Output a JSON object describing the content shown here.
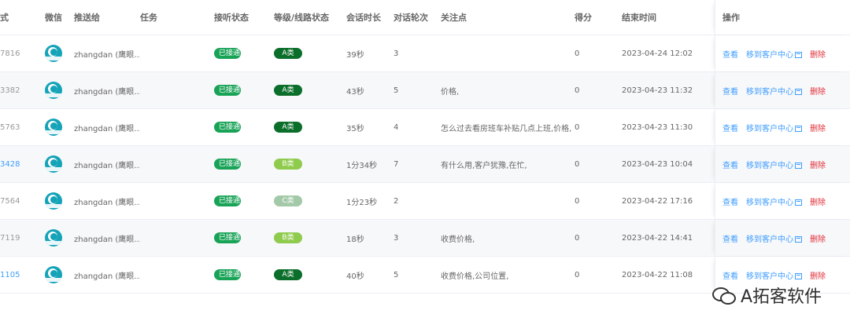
{
  "header": {
    "id": "式",
    "wechat": "微信",
    "push_to": "推送给",
    "task": "任务",
    "listen_status": "接听状态",
    "level": "等级/线路状态",
    "duration": "会话时长",
    "rounds": "对话轮次",
    "focus": "关注点",
    "score": "得分",
    "end_time": "结束时间",
    "ops": "操作"
  },
  "ops": {
    "view": "查看",
    "move": "移到客户中心",
    "delete": "删除"
  },
  "rows": [
    {
      "id": "7816",
      "id_link": false,
      "push_to": "zhangdan (鹰眼...",
      "listen": "已接通",
      "level": "A类",
      "level_class": "A",
      "duration": "39秒",
      "rounds": "3",
      "focus": "",
      "score": "0",
      "end_time": "2023-04-24 12:02"
    },
    {
      "id": "3382",
      "id_link": false,
      "push_to": "zhangdan (鹰眼...",
      "listen": "已接通",
      "level": "A类",
      "level_class": "A",
      "duration": "43秒",
      "rounds": "5",
      "focus": "价格,",
      "score": "0",
      "end_time": "2023-04-23 11:32"
    },
    {
      "id": "5763",
      "id_link": false,
      "push_to": "zhangdan (鹰眼...",
      "listen": "已接通",
      "level": "A类",
      "level_class": "A",
      "duration": "35秒",
      "rounds": "4",
      "focus": "怎么过去看房班车补贴几点上班,价格,",
      "score": "0",
      "end_time": "2023-04-23 11:30"
    },
    {
      "id": "3428",
      "id_link": true,
      "push_to": "zhangdan (鹰眼...",
      "listen": "已接通",
      "level": "B类",
      "level_class": "B",
      "duration": "1分34秒",
      "rounds": "7",
      "focus": "有什么用,客户犹豫,在忙,",
      "score": "0",
      "end_time": "2023-04-23 10:04"
    },
    {
      "id": "7564",
      "id_link": false,
      "push_to": "zhangdan (鹰眼...",
      "listen": "已接通",
      "level": "C类",
      "level_class": "C",
      "duration": "1分23秒",
      "rounds": "2",
      "focus": "",
      "score": "0",
      "end_time": "2023-04-22 17:16"
    },
    {
      "id": "7119",
      "id_link": false,
      "push_to": "zhangdan (鹰眼...",
      "listen": "已接通",
      "level": "B类",
      "level_class": "B",
      "duration": "18秒",
      "rounds": "3",
      "focus": "收费价格,",
      "score": "0",
      "end_time": "2023-04-22 14:41"
    },
    {
      "id": "1105",
      "id_link": true,
      "push_to": "zhangdan (鹰眼...",
      "listen": "已接通",
      "level": "A类",
      "level_class": "A",
      "duration": "40秒",
      "rounds": "5",
      "focus": "收费价格,公司位置,",
      "score": "0",
      "end_time": "2023-04-22 11:08"
    }
  ],
  "watermark": "A拓客软件",
  "colors": {
    "link": "#409eff",
    "delete": "#e0303a",
    "connected": "#19a357",
    "level_A": "#0b6e2a",
    "level_B": "#8fcb4c",
    "level_C": "#a3c9a8"
  }
}
